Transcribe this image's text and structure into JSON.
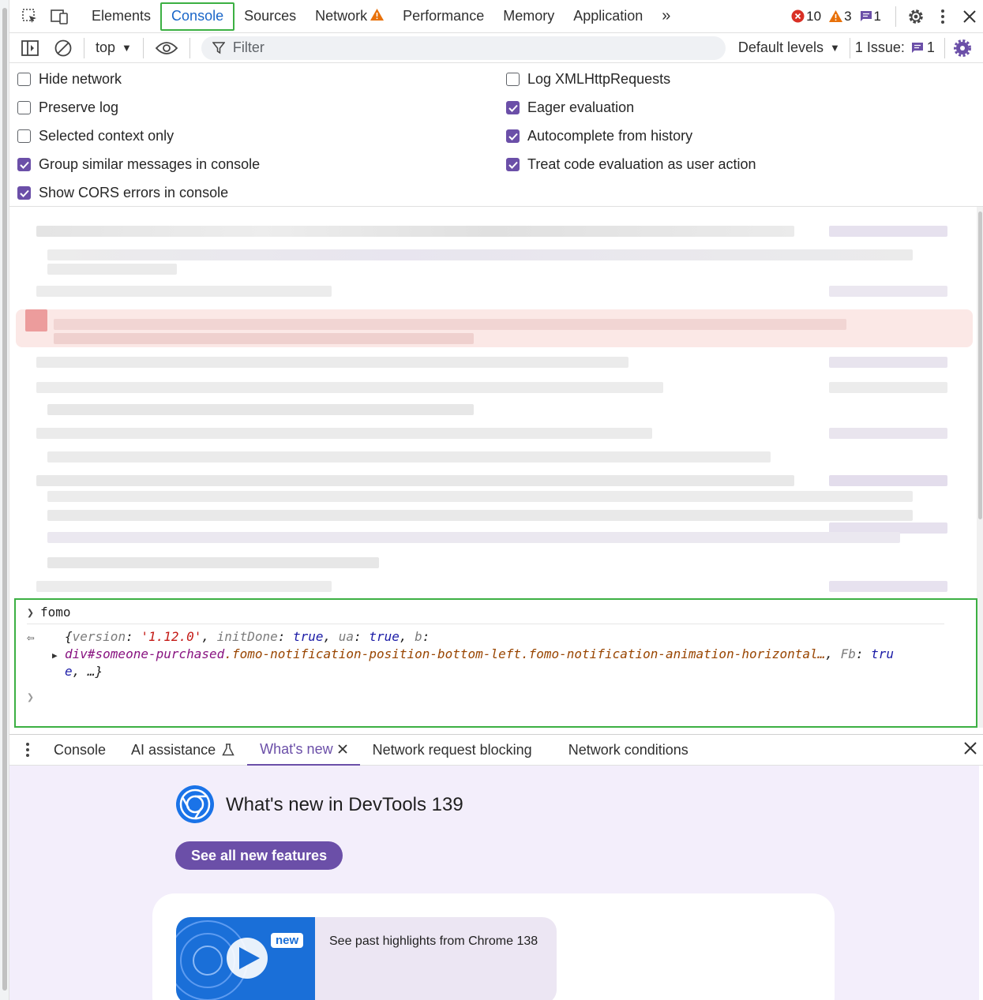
{
  "tabs": {
    "elements": "Elements",
    "console": "Console",
    "sources": "Sources",
    "network": "Network",
    "performance": "Performance",
    "memory": "Memory",
    "application": "Application"
  },
  "counts": {
    "errors": "10",
    "warnings": "3",
    "messages": "1"
  },
  "toolbar": {
    "context": "top",
    "filter_placeholder": "Filter",
    "levels": "Default levels",
    "issues_label": "1 Issue:",
    "issues_count": "1"
  },
  "settings": {
    "left": [
      {
        "label": "Hide network",
        "checked": false
      },
      {
        "label": "Preserve log",
        "checked": false
      },
      {
        "label": "Selected context only",
        "checked": false
      },
      {
        "label": "Group similar messages in console",
        "checked": true
      },
      {
        "label": "Show CORS errors in console",
        "checked": true
      }
    ],
    "right": [
      {
        "label": "Log XMLHttpRequests",
        "checked": false
      },
      {
        "label": "Eager evaluation",
        "checked": true
      },
      {
        "label": "Autocomplete from history",
        "checked": true
      },
      {
        "label": "Treat code evaluation as user action",
        "checked": true
      }
    ]
  },
  "evaluation": {
    "input": "fomo",
    "out_version_key": "version",
    "out_version_val": "'1.12.0'",
    "out_init_key": "initDone",
    "out_init_val": "true",
    "out_ua_key": "ua",
    "out_ua_val": "true",
    "out_b_key": "b",
    "out_el": "div#someone-purchased",
    "out_class": ".fomo-notification-position-bottom-left.fomo-notification-animation-horizontal…",
    "out_fb_key": "Fb",
    "out_fb_val_1": "tru",
    "out_fb_val_2": "e",
    "out_tail": "…}"
  },
  "drawer": {
    "tabs": [
      "Console",
      "AI assistance",
      "What's new",
      "Network request blocking",
      "Network conditions"
    ],
    "title": "What's new in DevTools 139",
    "see_all": "See all new features",
    "badge": "new",
    "highlight": "See past highlights from Chrome 138"
  },
  "colors": {
    "accent": "#6b4fa8",
    "highlight_border": "#3cb043",
    "link": "#1a66c8"
  }
}
